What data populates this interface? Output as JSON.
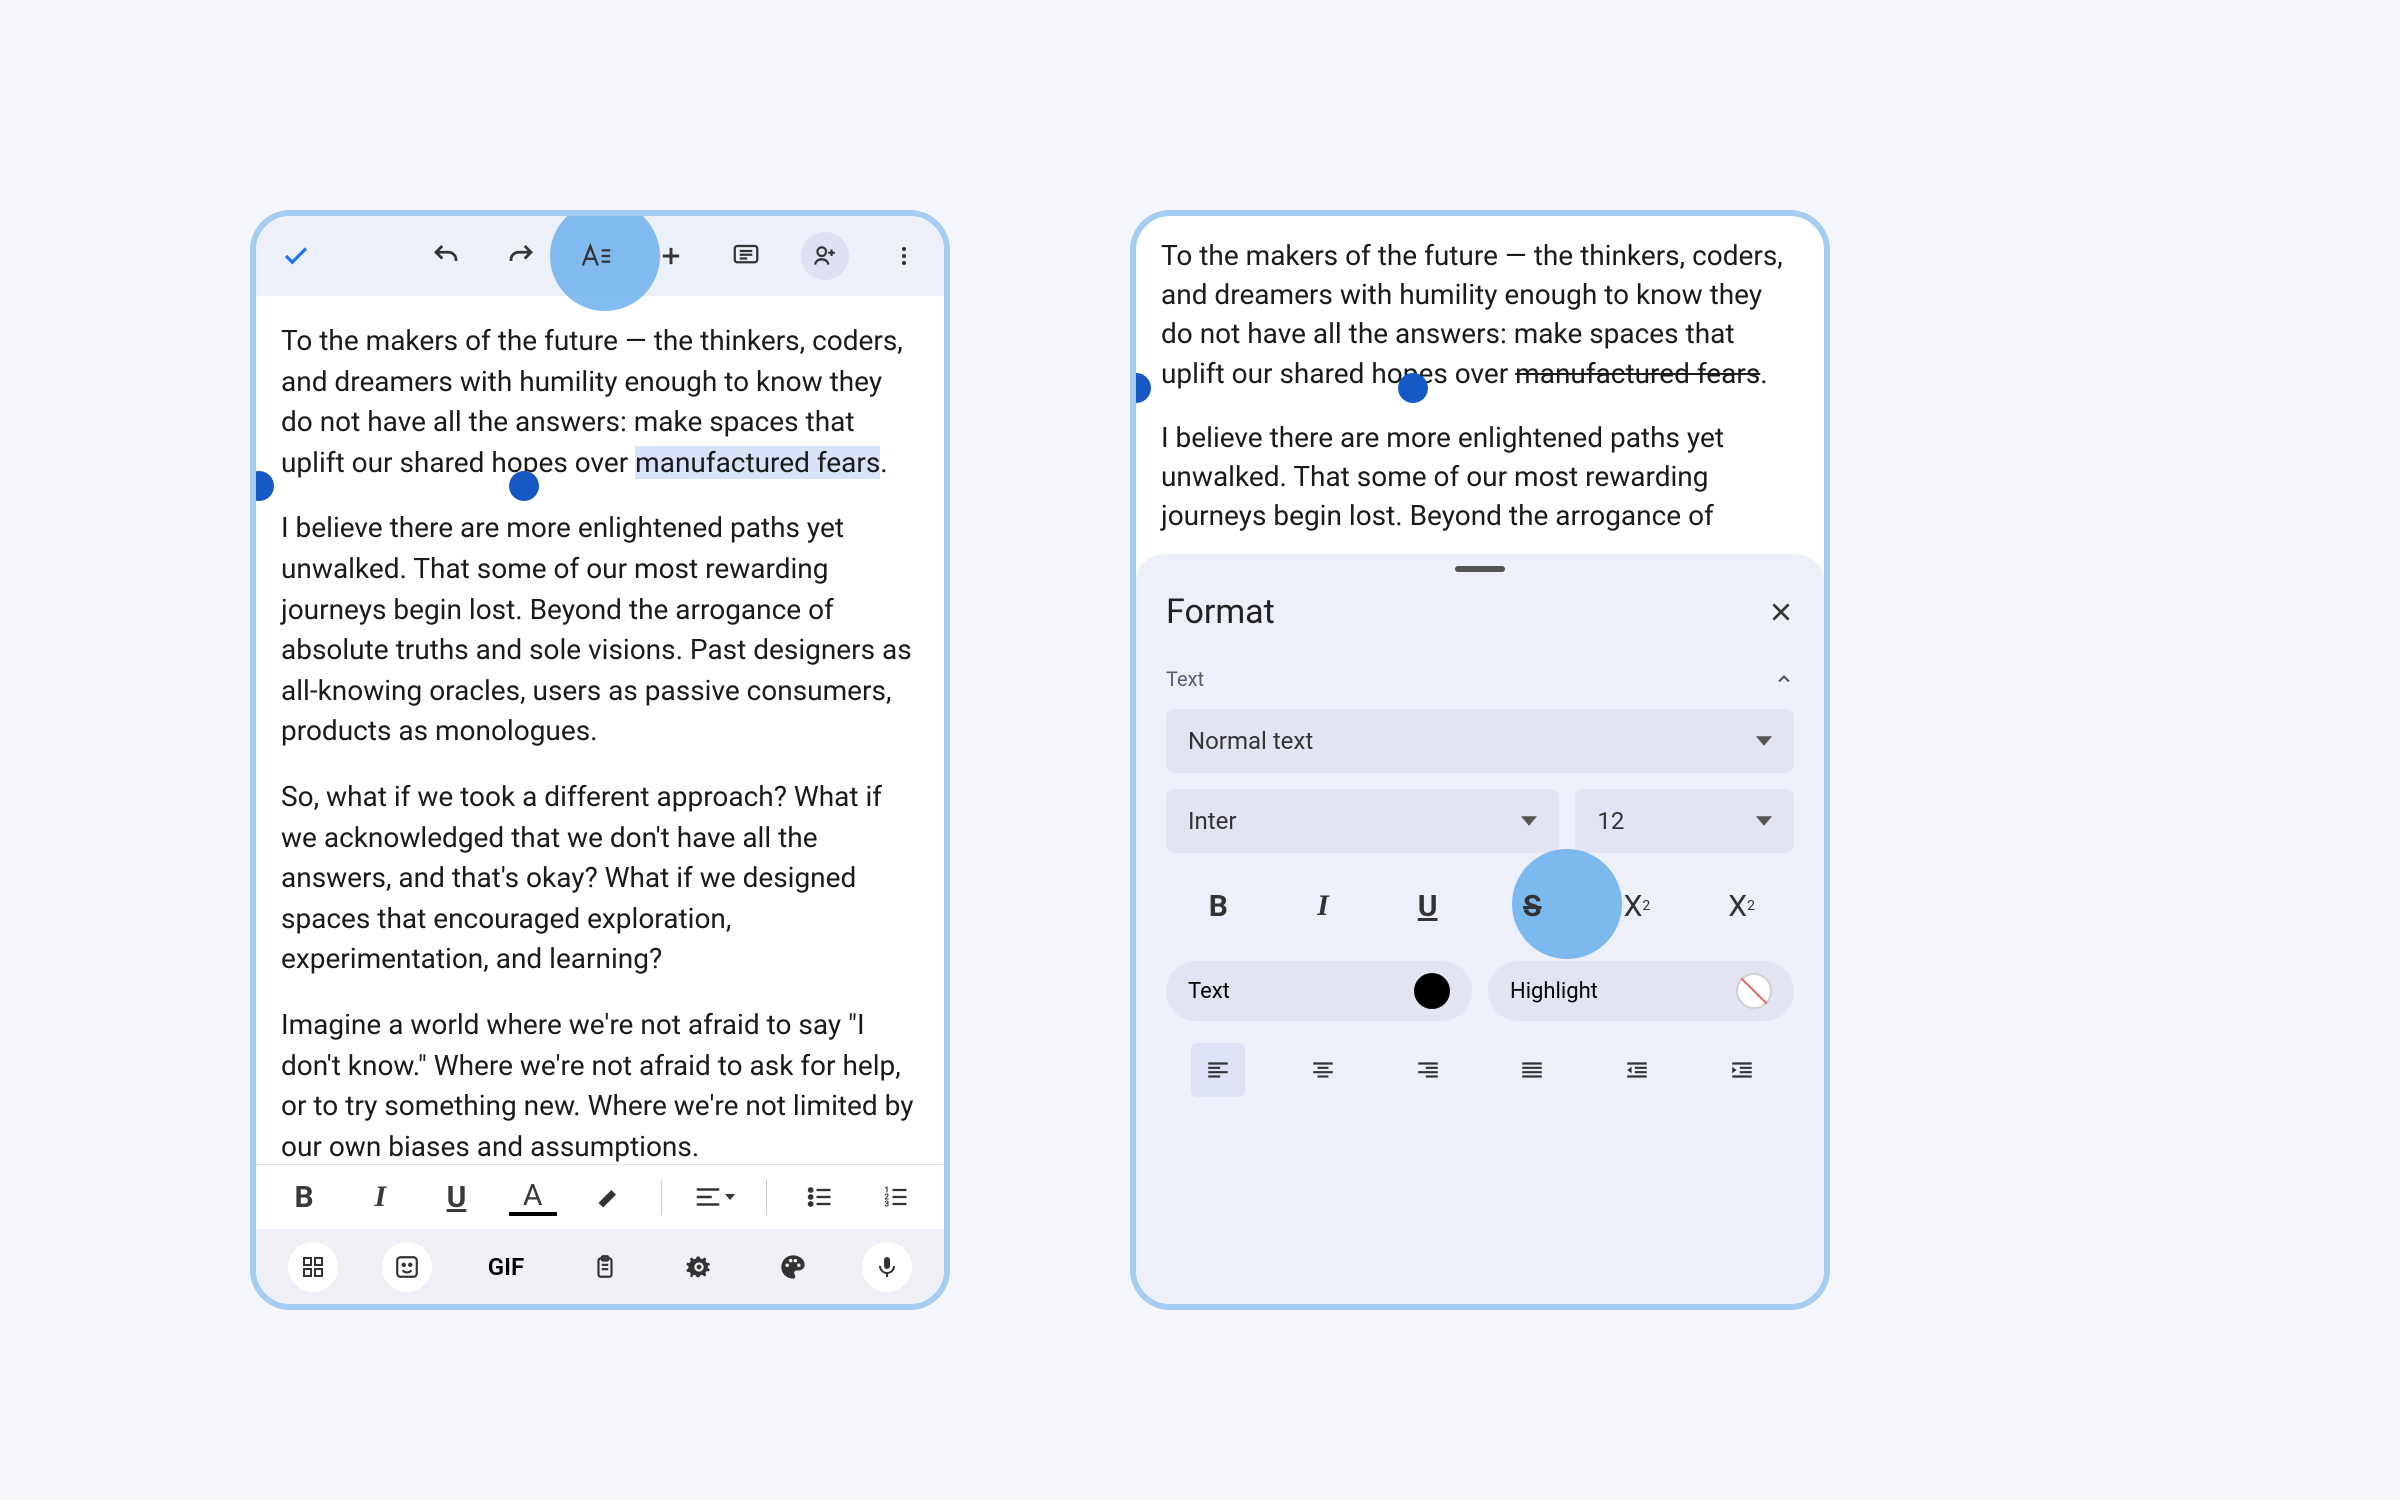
{
  "phone1": {
    "paragraphs": {
      "p1_before": "To the makers of the future — the thinkers, coders, and dreamers with humility enough to know they do not have all the answers: make spaces that uplift our shared hopes over ",
      "p1_sel": "manufactured fears",
      "p1_after": ".",
      "p2": "I believe there are more enlightened paths yet unwalked. That some of our most rewarding journeys begin lost. Beyond the arrogance of absolute truths and sole visions. Past designers as all-knowing oracles, users as passive consumers, products as monologues.",
      "p3": "So, what if we took a different approach? What if we acknowledged that we don't have all the answers, and that's okay? What if we designed spaces that encouraged exploration, experimentation, and learning?",
      "p4": "Imagine a world where we're not afraid to say \"I don't know.\" Where we're not afraid to ask for help, or to try something new. Where we're not limited by our own biases and assumptions."
    },
    "toolbar": {
      "bold": "B",
      "italic": "I",
      "underline": "U",
      "textcolor": "A"
    },
    "keyboard": {
      "gif": "GIF"
    }
  },
  "phone2": {
    "paragraphs": {
      "p1_before": "To the makers of the future — the thinkers, coders, and dreamers with humility enough to know they do not have all the answers: make spaces that uplift our shared hopes over ",
      "p1_strike": "manufactured fears",
      "p1_after": ".",
      "p2": "I believe there are more enlightened paths yet unwalked. That some of our most rewarding journeys begin lost. Beyond the arrogance of"
    },
    "sheet": {
      "title": "Format",
      "section_text": "Text",
      "style_select": "Normal text",
      "font_select": "Inter",
      "size_select": "12",
      "text_label": "Text",
      "highlight_label": "Highlight"
    }
  }
}
